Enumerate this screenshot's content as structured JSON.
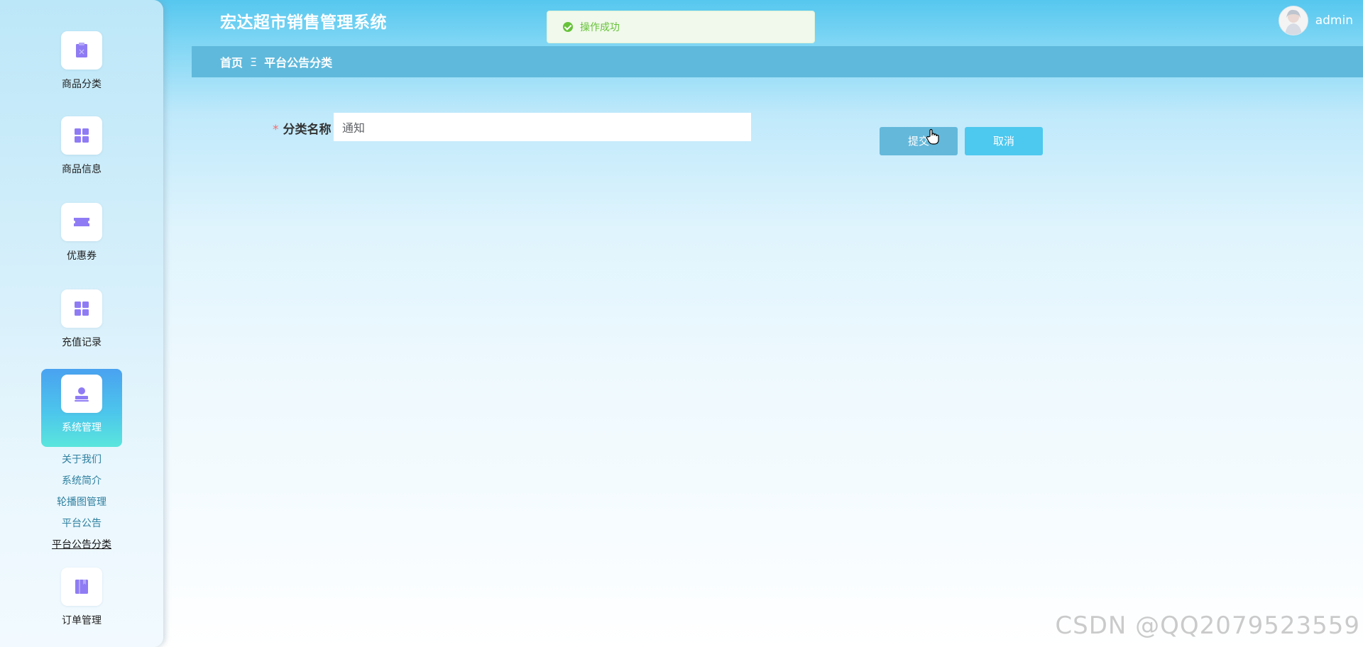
{
  "app": {
    "title": "宏达超市销售管理系统"
  },
  "user": {
    "name": "admin"
  },
  "toast": {
    "message": "操作成功"
  },
  "breadcrumb": {
    "home": "首页",
    "separator": "Ξ",
    "current": "平台公告分类"
  },
  "sidebar": {
    "items": [
      {
        "label": "商品分类",
        "icon": "clipboard-icon"
      },
      {
        "label": "商品信息",
        "icon": "grid-icon"
      },
      {
        "label": "优惠券",
        "icon": "ticket-icon"
      },
      {
        "label": "充值记录",
        "icon": "grid-icon"
      },
      {
        "label": "系统管理",
        "icon": "user-stamp-icon",
        "active": true
      },
      {
        "label": "订单管理",
        "icon": "book-icon"
      }
    ],
    "submenu": [
      "关于我们",
      "系统简介",
      "轮播图管理",
      "平台公告",
      "平台公告分类"
    ]
  },
  "form": {
    "field_label": "分类名称",
    "required_mark": "*",
    "field_value": "通知",
    "submit_label": "提交",
    "cancel_label": "取消"
  },
  "watermark": {
    "text": "CSDN @QQ2079523559"
  },
  "colors": {
    "accent": "#5fb9dc",
    "active_nav": "#4cc5ec",
    "success": "#67c23a",
    "icon_purple": "#8f7cf4"
  }
}
